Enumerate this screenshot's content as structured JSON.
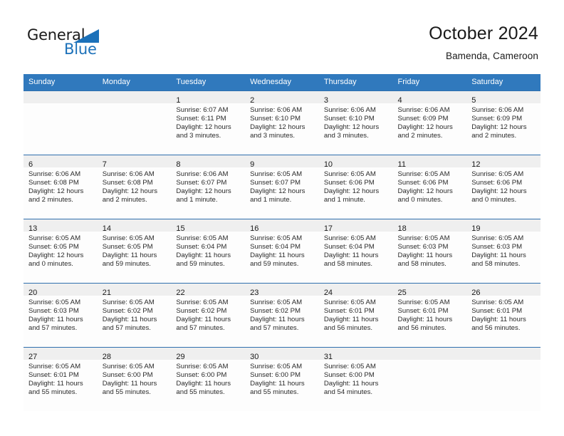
{
  "brand": {
    "word_one": "General",
    "word_two": "Blue",
    "triangle_color": "#1c71b9",
    "text_color": "#1a1a1a"
  },
  "header": {
    "title": "October 2024",
    "subtitle": "Bamenda, Cameroon"
  },
  "colors": {
    "header_row_background": "#3079bd",
    "header_row_text": "#ffffff",
    "daynum_band_background": "#efefef",
    "cell_background": "#fdfdfd",
    "grid_line": "#2f6fae",
    "body_text": "#2a2a2a"
  },
  "weekday_headers": [
    "Sunday",
    "Monday",
    "Tuesday",
    "Wednesday",
    "Thursday",
    "Friday",
    "Saturday"
  ],
  "weeks": [
    [
      {
        "day": "",
        "sunrise": "",
        "sunset": "",
        "daylight_line1": "",
        "daylight_line2": ""
      },
      {
        "day": "",
        "sunrise": "",
        "sunset": "",
        "daylight_line1": "",
        "daylight_line2": ""
      },
      {
        "day": "1",
        "sunrise": "Sunrise: 6:07 AM",
        "sunset": "Sunset: 6:11 PM",
        "daylight_line1": "Daylight: 12 hours",
        "daylight_line2": "and 3 minutes."
      },
      {
        "day": "2",
        "sunrise": "Sunrise: 6:06 AM",
        "sunset": "Sunset: 6:10 PM",
        "daylight_line1": "Daylight: 12 hours",
        "daylight_line2": "and 3 minutes."
      },
      {
        "day": "3",
        "sunrise": "Sunrise: 6:06 AM",
        "sunset": "Sunset: 6:10 PM",
        "daylight_line1": "Daylight: 12 hours",
        "daylight_line2": "and 3 minutes."
      },
      {
        "day": "4",
        "sunrise": "Sunrise: 6:06 AM",
        "sunset": "Sunset: 6:09 PM",
        "daylight_line1": "Daylight: 12 hours",
        "daylight_line2": "and 2 minutes."
      },
      {
        "day": "5",
        "sunrise": "Sunrise: 6:06 AM",
        "sunset": "Sunset: 6:09 PM",
        "daylight_line1": "Daylight: 12 hours",
        "daylight_line2": "and 2 minutes."
      }
    ],
    [
      {
        "day": "6",
        "sunrise": "Sunrise: 6:06 AM",
        "sunset": "Sunset: 6:08 PM",
        "daylight_line1": "Daylight: 12 hours",
        "daylight_line2": "and 2 minutes."
      },
      {
        "day": "7",
        "sunrise": "Sunrise: 6:06 AM",
        "sunset": "Sunset: 6:08 PM",
        "daylight_line1": "Daylight: 12 hours",
        "daylight_line2": "and 2 minutes."
      },
      {
        "day": "8",
        "sunrise": "Sunrise: 6:06 AM",
        "sunset": "Sunset: 6:07 PM",
        "daylight_line1": "Daylight: 12 hours",
        "daylight_line2": "and 1 minute."
      },
      {
        "day": "9",
        "sunrise": "Sunrise: 6:05 AM",
        "sunset": "Sunset: 6:07 PM",
        "daylight_line1": "Daylight: 12 hours",
        "daylight_line2": "and 1 minute."
      },
      {
        "day": "10",
        "sunrise": "Sunrise: 6:05 AM",
        "sunset": "Sunset: 6:06 PM",
        "daylight_line1": "Daylight: 12 hours",
        "daylight_line2": "and 1 minute."
      },
      {
        "day": "11",
        "sunrise": "Sunrise: 6:05 AM",
        "sunset": "Sunset: 6:06 PM",
        "daylight_line1": "Daylight: 12 hours",
        "daylight_line2": "and 0 minutes."
      },
      {
        "day": "12",
        "sunrise": "Sunrise: 6:05 AM",
        "sunset": "Sunset: 6:06 PM",
        "daylight_line1": "Daylight: 12 hours",
        "daylight_line2": "and 0 minutes."
      }
    ],
    [
      {
        "day": "13",
        "sunrise": "Sunrise: 6:05 AM",
        "sunset": "Sunset: 6:05 PM",
        "daylight_line1": "Daylight: 12 hours",
        "daylight_line2": "and 0 minutes."
      },
      {
        "day": "14",
        "sunrise": "Sunrise: 6:05 AM",
        "sunset": "Sunset: 6:05 PM",
        "daylight_line1": "Daylight: 11 hours",
        "daylight_line2": "and 59 minutes."
      },
      {
        "day": "15",
        "sunrise": "Sunrise: 6:05 AM",
        "sunset": "Sunset: 6:04 PM",
        "daylight_line1": "Daylight: 11 hours",
        "daylight_line2": "and 59 minutes."
      },
      {
        "day": "16",
        "sunrise": "Sunrise: 6:05 AM",
        "sunset": "Sunset: 6:04 PM",
        "daylight_line1": "Daylight: 11 hours",
        "daylight_line2": "and 59 minutes."
      },
      {
        "day": "17",
        "sunrise": "Sunrise: 6:05 AM",
        "sunset": "Sunset: 6:04 PM",
        "daylight_line1": "Daylight: 11 hours",
        "daylight_line2": "and 58 minutes."
      },
      {
        "day": "18",
        "sunrise": "Sunrise: 6:05 AM",
        "sunset": "Sunset: 6:03 PM",
        "daylight_line1": "Daylight: 11 hours",
        "daylight_line2": "and 58 minutes."
      },
      {
        "day": "19",
        "sunrise": "Sunrise: 6:05 AM",
        "sunset": "Sunset: 6:03 PM",
        "daylight_line1": "Daylight: 11 hours",
        "daylight_line2": "and 58 minutes."
      }
    ],
    [
      {
        "day": "20",
        "sunrise": "Sunrise: 6:05 AM",
        "sunset": "Sunset: 6:03 PM",
        "daylight_line1": "Daylight: 11 hours",
        "daylight_line2": "and 57 minutes."
      },
      {
        "day": "21",
        "sunrise": "Sunrise: 6:05 AM",
        "sunset": "Sunset: 6:02 PM",
        "daylight_line1": "Daylight: 11 hours",
        "daylight_line2": "and 57 minutes."
      },
      {
        "day": "22",
        "sunrise": "Sunrise: 6:05 AM",
        "sunset": "Sunset: 6:02 PM",
        "daylight_line1": "Daylight: 11 hours",
        "daylight_line2": "and 57 minutes."
      },
      {
        "day": "23",
        "sunrise": "Sunrise: 6:05 AM",
        "sunset": "Sunset: 6:02 PM",
        "daylight_line1": "Daylight: 11 hours",
        "daylight_line2": "and 57 minutes."
      },
      {
        "day": "24",
        "sunrise": "Sunrise: 6:05 AM",
        "sunset": "Sunset: 6:01 PM",
        "daylight_line1": "Daylight: 11 hours",
        "daylight_line2": "and 56 minutes."
      },
      {
        "day": "25",
        "sunrise": "Sunrise: 6:05 AM",
        "sunset": "Sunset: 6:01 PM",
        "daylight_line1": "Daylight: 11 hours",
        "daylight_line2": "and 56 minutes."
      },
      {
        "day": "26",
        "sunrise": "Sunrise: 6:05 AM",
        "sunset": "Sunset: 6:01 PM",
        "daylight_line1": "Daylight: 11 hours",
        "daylight_line2": "and 56 minutes."
      }
    ],
    [
      {
        "day": "27",
        "sunrise": "Sunrise: 6:05 AM",
        "sunset": "Sunset: 6:01 PM",
        "daylight_line1": "Daylight: 11 hours",
        "daylight_line2": "and 55 minutes."
      },
      {
        "day": "28",
        "sunrise": "Sunrise: 6:05 AM",
        "sunset": "Sunset: 6:00 PM",
        "daylight_line1": "Daylight: 11 hours",
        "daylight_line2": "and 55 minutes."
      },
      {
        "day": "29",
        "sunrise": "Sunrise: 6:05 AM",
        "sunset": "Sunset: 6:00 PM",
        "daylight_line1": "Daylight: 11 hours",
        "daylight_line2": "and 55 minutes."
      },
      {
        "day": "30",
        "sunrise": "Sunrise: 6:05 AM",
        "sunset": "Sunset: 6:00 PM",
        "daylight_line1": "Daylight: 11 hours",
        "daylight_line2": "and 55 minutes."
      },
      {
        "day": "31",
        "sunrise": "Sunrise: 6:05 AM",
        "sunset": "Sunset: 6:00 PM",
        "daylight_line1": "Daylight: 11 hours",
        "daylight_line2": "and 54 minutes."
      },
      {
        "day": "",
        "sunrise": "",
        "sunset": "",
        "daylight_line1": "",
        "daylight_line2": ""
      },
      {
        "day": "",
        "sunrise": "",
        "sunset": "",
        "daylight_line1": "",
        "daylight_line2": ""
      }
    ]
  ]
}
